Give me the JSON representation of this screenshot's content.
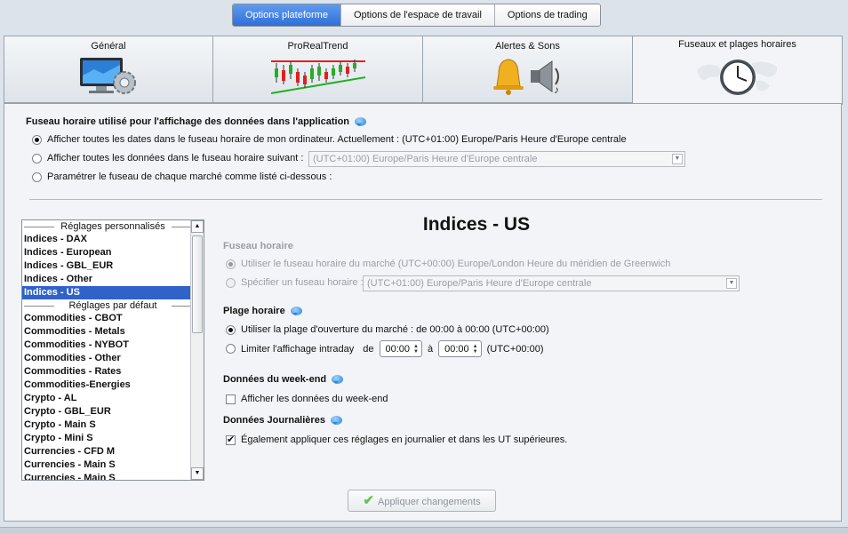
{
  "top_tabs": [
    {
      "label": "Options plateforme",
      "active": true
    },
    {
      "label": "Options de l'espace de travail",
      "active": false
    },
    {
      "label": "Options de trading",
      "active": false
    }
  ],
  "category_tabs": [
    {
      "label": "Général",
      "icon": "monitor-gear-icon"
    },
    {
      "label": "ProRealTrend",
      "icon": "trend-chart-icon"
    },
    {
      "label": "Alertes & Sons",
      "icon": "bell-speaker-icon"
    },
    {
      "label": "Fuseaux et plages horaires",
      "icon": "world-clock-icon",
      "active": true
    }
  ],
  "timezone_section": {
    "title": "Fuseau horaire utilisé pour l'affichage des données dans l'application",
    "option_computer": "Afficher toutes les dates dans le fuseau horaire de mon ordinateur. Actuellement : (UTC+01:00) Europe/Paris Heure d'Europe centrale",
    "option_following": "Afficher toutes les données dans le fuseau horaire suivant :",
    "following_value": "(UTC+01:00) Europe/Paris Heure d'Europe centrale",
    "option_per_market": "Paramétrer le fuseau de chaque marché comme listé ci-dessous :",
    "selected": "computer"
  },
  "market_list": {
    "header_custom": "Réglages personnalisés",
    "custom_items": [
      "Indices - DAX",
      "Indices - European",
      "Indices - GBL_EUR",
      "Indices - Other",
      "Indices - US"
    ],
    "selected_item": "Indices - US",
    "header_default": "Réglages par défaut",
    "default_items": [
      "Commodities - CBOT",
      "Commodities - Metals",
      "Commodities - NYBOT",
      "Commodities - Other",
      "Commodities - Rates",
      "Commodities-Energies",
      "Crypto - AL",
      "Crypto - GBL_EUR",
      "Crypto - Main S",
      "Crypto - Mini S",
      "Currencies - CFD M",
      "Currencies - Main S",
      "Currencies - Main S"
    ]
  },
  "detail": {
    "title": "Indices - US",
    "tz_label": "Fuseau horaire",
    "tz_market_option": "Utiliser le fuseau horaire du marché (UTC+00:00) Europe/London Heure du méridien de Greenwich",
    "tz_specify_option": "Spécifier un fuseau horaire :",
    "tz_specify_value": "(UTC+01:00) Europe/Paris Heure d'Europe centrale",
    "hours_label": "Plage horaire",
    "hours_market_option": "Utiliser la plage d'ouverture du marché : de 00:00 à 00:00  (UTC+00:00)",
    "hours_limit_option": "Limiter l'affichage intraday",
    "hours_from_label": "de",
    "hours_from": "00:00",
    "hours_to_label": "à",
    "hours_to": "00:00",
    "hours_tz": "(UTC+00:00)",
    "weekend_label": "Données du week-end",
    "weekend_option": "Afficher les données du week-end",
    "weekend_checked": false,
    "daily_label": "Données Journalières",
    "daily_option": "Également appliquer ces réglages en journalier et dans les UT supérieures.",
    "daily_checked": true
  },
  "apply_button": "Appliquer changements"
}
